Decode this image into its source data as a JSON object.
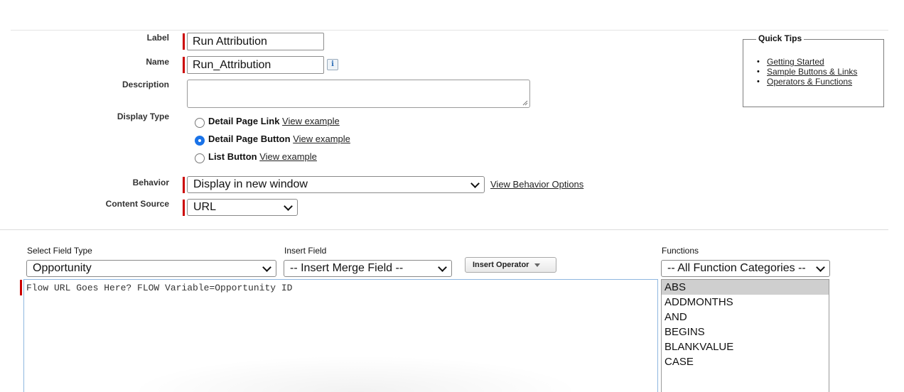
{
  "form": {
    "label": {
      "caption": "Label",
      "value": "Run Attribution"
    },
    "name": {
      "caption": "Name",
      "value": "Run_Attribution",
      "info_glyph": "i"
    },
    "description": {
      "caption": "Description",
      "value": ""
    },
    "display_type": {
      "caption": "Display Type",
      "options": [
        {
          "label": "Detail Page Link",
          "link": "View example",
          "checked": false
        },
        {
          "label": "Detail Page Button",
          "link": "View example",
          "checked": true
        },
        {
          "label": "List Button",
          "link": "View example",
          "checked": false
        }
      ]
    },
    "behavior": {
      "caption": "Behavior",
      "value": "Display in new window",
      "link": "View Behavior Options"
    },
    "content_source": {
      "caption": "Content Source",
      "value": "URL"
    }
  },
  "quick_tips": {
    "title": "Quick Tips",
    "links": [
      "Getting Started",
      "Sample Buttons & Links",
      "Operators & Functions"
    ]
  },
  "editor_toolbar": {
    "select_field_type": {
      "caption": "Select Field Type",
      "value": "Opportunity"
    },
    "insert_field": {
      "caption": "Insert Field",
      "value": "-- Insert Merge Field --"
    },
    "insert_operator": {
      "label": "Insert Operator"
    },
    "functions": {
      "caption": "Functions",
      "value": "-- All Function Categories --"
    }
  },
  "editor": {
    "content": "Flow URL Goes Here? FLOW Variable=Opportunity ID"
  },
  "functions_list": {
    "items": [
      "ABS",
      "ADDMONTHS",
      "AND",
      "BEGINS",
      "BLANKVALUE",
      "CASE"
    ],
    "selected": "ABS"
  },
  "colors": {
    "required_bar": "#cc0000",
    "selected_radio": "#1a73e8",
    "editor_border": "#8fb7e0",
    "list_selected": "#cfcfcf"
  }
}
